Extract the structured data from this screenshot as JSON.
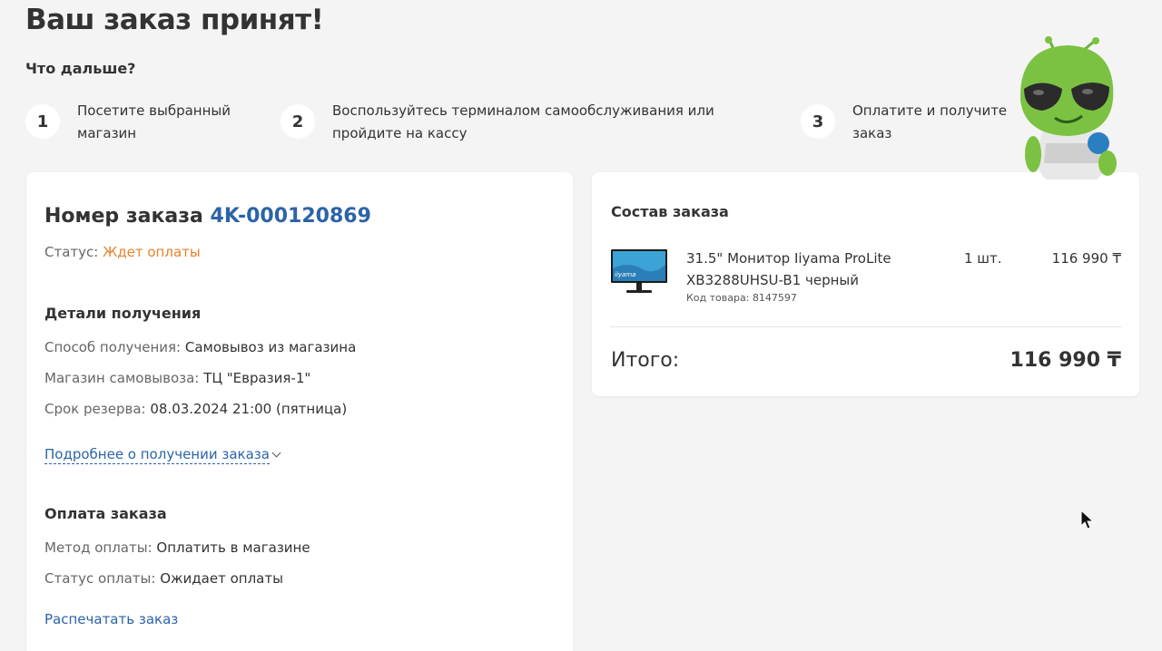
{
  "header": {
    "title": "Ваш заказ принят!",
    "next_title": "Что дальше?"
  },
  "steps": [
    {
      "num": "1",
      "text": "Посетите выбранный магазин"
    },
    {
      "num": "2",
      "text": "Воспользуйтесь терминалом самообслуживания или пройдите на кассу"
    },
    {
      "num": "3",
      "text": "Оплатите и получите заказ"
    }
  ],
  "order": {
    "number_label": "Номер заказа",
    "number": "4K-000120869",
    "status_label": "Статус:",
    "status_value": "Ждет оплаты",
    "delivery": {
      "title": "Детали получения",
      "method_label": "Способ получения:",
      "method_value": "Самовывоз из магазина",
      "store_label": "Магазин самовывоза:",
      "store_value": "ТЦ \"Евразия-1\"",
      "reserve_label": "Срок резерва:",
      "reserve_value": "08.03.2024 21:00 (пятница)",
      "more_link": "Подробнее о получении заказа"
    },
    "payment": {
      "title": "Оплата заказа",
      "method_label": "Метод оплаты:",
      "method_value": "Оплатить в магазине",
      "status_label": "Статус оплаты:",
      "status_value": "Ожидает оплаты",
      "print_link": "Распечатать заказ"
    }
  },
  "summary": {
    "title": "Состав заказа",
    "items": [
      {
        "name": "31.5\" Монитор Iiyama ProLite XB3288UHSU-B1 черный",
        "code": "Код товара: 8147597",
        "qty": "1 шт.",
        "price": "116 990 ₸",
        "brand_text": "iiyama"
      }
    ],
    "total_label": "Итого:",
    "total_value": "116 990 ₸"
  },
  "colors": {
    "accent_blue": "#2c63a8",
    "status_orange": "#e8822c",
    "background": "#f4f4f4",
    "mascot_green": "#7cc242"
  },
  "icons": [
    "chevron-down-icon",
    "alien-mascot",
    "mouse-cursor-icon",
    "monitor-product-image"
  ]
}
